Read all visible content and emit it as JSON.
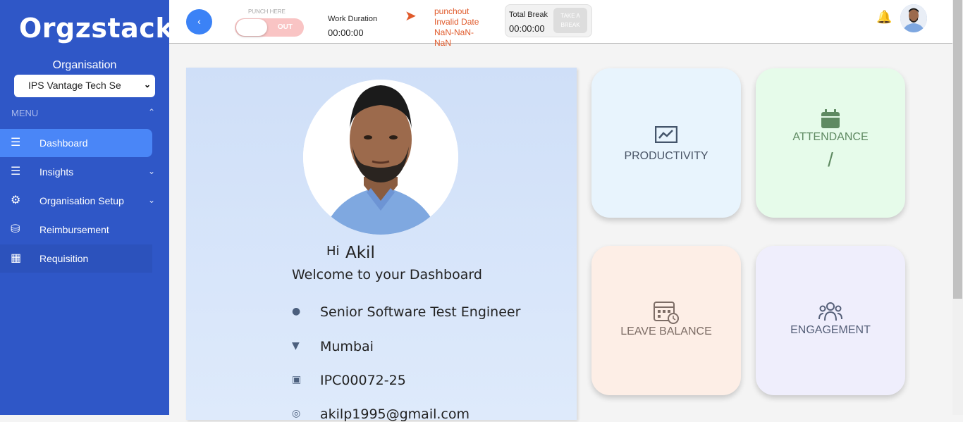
{
  "app": {
    "logo_text": "Orgzstack"
  },
  "sidebar": {
    "org_label": "Organisation",
    "org_selected": "IPS Vantage Tech Se",
    "menu_label": "MENU",
    "items": [
      {
        "label": "Dashboard",
        "icon": "dashboard-icon"
      },
      {
        "label": "Insights",
        "icon": "insights-icon"
      },
      {
        "label": "Organisation Setup",
        "icon": "org-setup-icon"
      },
      {
        "label": "Reimbursement",
        "icon": "reimbursement-icon"
      },
      {
        "label": "Requisition",
        "icon": "requisition-icon"
      }
    ]
  },
  "topbar": {
    "punch_here_label": "PUNCH HERE",
    "punch_toggle_text": "OUT",
    "work_duration_label": "Work Duration",
    "work_duration_value": "00:00:00",
    "punchout_status": "punchout Invalid Date NaN-NaN-NaN",
    "total_break_label": "Total Break",
    "total_break_value": "00:00:00",
    "take_break_label": "TAKE A BREAK"
  },
  "profile": {
    "greeting": "Hi",
    "name": "Akil",
    "welcome": "Welcome to your Dashboard",
    "designation": "Senior Software Test Engineer",
    "location": "Mumbai",
    "employee_id": "IPC00072-25",
    "email": "akilp1995@gmail.com"
  },
  "tiles": {
    "productivity": {
      "label": "PRODUCTIVITY",
      "color": "#e8f4fd"
    },
    "attendance": {
      "label": "ATTENDANCE",
      "value": "/",
      "color": "#e6fbea"
    },
    "leave_balance": {
      "label": "LEAVE BALANCE",
      "color": "#fdeee6"
    },
    "engagement": {
      "label": "ENGAGEMENT",
      "color": "#efeefc"
    }
  },
  "colors": {
    "sidebar": "#2f57c7",
    "active": "#4a86f7",
    "accent_orange": "#e05a2b"
  }
}
